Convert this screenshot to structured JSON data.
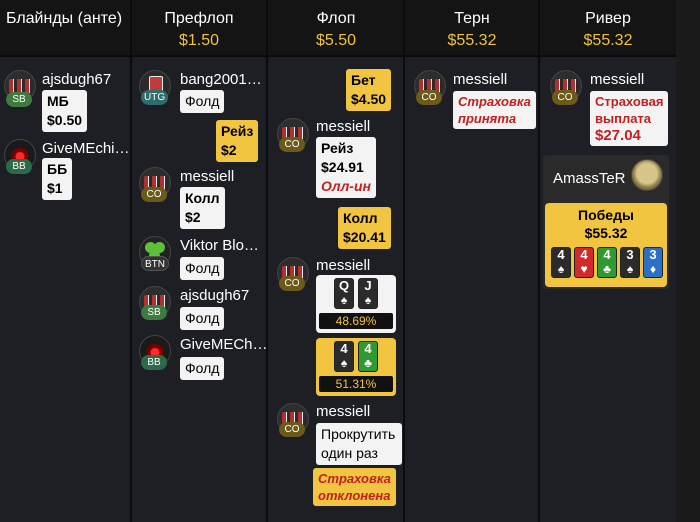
{
  "header": {
    "blinds": "Блайнды (анте)",
    "preflop": {
      "name": "Префлоп",
      "pot": "$1.50"
    },
    "flop": {
      "name": "Флоп",
      "pot": "$5.50"
    },
    "turn": {
      "name": "Терн",
      "pot": "$55.32"
    },
    "river": {
      "name": "Ривер",
      "pot": "$55.32"
    }
  },
  "blinds": {
    "p1": {
      "name": "ajsdugh67",
      "pos": "SB",
      "action": "МБ",
      "amount": "$0.50"
    },
    "p2": {
      "name": "GiveMEchi…",
      "pos": "BB",
      "action": "ББ",
      "amount": "$1"
    }
  },
  "preflop": {
    "p1": {
      "name": "bang2001…",
      "pos": "UTG",
      "action": "Фолд"
    },
    "raise": {
      "action": "Рейз",
      "amount": "$2"
    },
    "p2": {
      "name": "messiell",
      "pos": "CO",
      "action": "Колл",
      "amount": "$2"
    },
    "p3": {
      "name": "Viktor Blo…",
      "pos": "BTN",
      "action": "Фолд"
    },
    "p4": {
      "name": "ajsdugh67",
      "pos": "SB",
      "action": "Фолд"
    },
    "p5": {
      "name": "GiveMECh…",
      "pos": "BB",
      "action": "Фолд"
    }
  },
  "flop": {
    "bet": {
      "action": "Бет",
      "amount": "$4.50"
    },
    "p1": {
      "name": "messiell",
      "pos": "CO",
      "action": "Рейз",
      "amount": "$24.91",
      "allin": "Олл-ин"
    },
    "call": {
      "action": "Колл",
      "amount": "$20.41"
    },
    "p2": {
      "name": "messiell",
      "pos": "CO",
      "card1": {
        "rank": "Q",
        "suit": "♠"
      },
      "card2": {
        "rank": "J",
        "suit": "♠"
      },
      "equity": "48.69%"
    },
    "opp": {
      "card1": {
        "rank": "4",
        "suit": "♠"
      },
      "card2": {
        "rank": "4",
        "suit": "♣"
      },
      "equity": "51.31%"
    },
    "p3": {
      "name": "messiell",
      "pos": "CO",
      "line1": "Прокрутить",
      "line2": "один раз"
    },
    "insurance": {
      "line1": "Страховка",
      "line2": "отклонена"
    }
  },
  "turn": {
    "p1": {
      "name": "messiell",
      "pos": "CO",
      "line1": "Страховка",
      "line2": "принята"
    }
  },
  "river": {
    "p1": {
      "name": "messiell",
      "pos": "CO",
      "line1": "Страховая",
      "line2": "выплата",
      "amount": "$27.04"
    },
    "winner": {
      "name": "AmassTeR",
      "label": "Победы",
      "amount": "$55.32"
    },
    "board": [
      {
        "rank": "4",
        "suit": "♠",
        "color": "spade"
      },
      {
        "rank": "4",
        "suit": "♥",
        "color": "heart"
      },
      {
        "rank": "4",
        "suit": "♣",
        "color": "club"
      },
      {
        "rank": "3",
        "suit": "♠",
        "color": "spade"
      },
      {
        "rank": "3",
        "suit": "♦",
        "color": "diamond"
      }
    ]
  }
}
